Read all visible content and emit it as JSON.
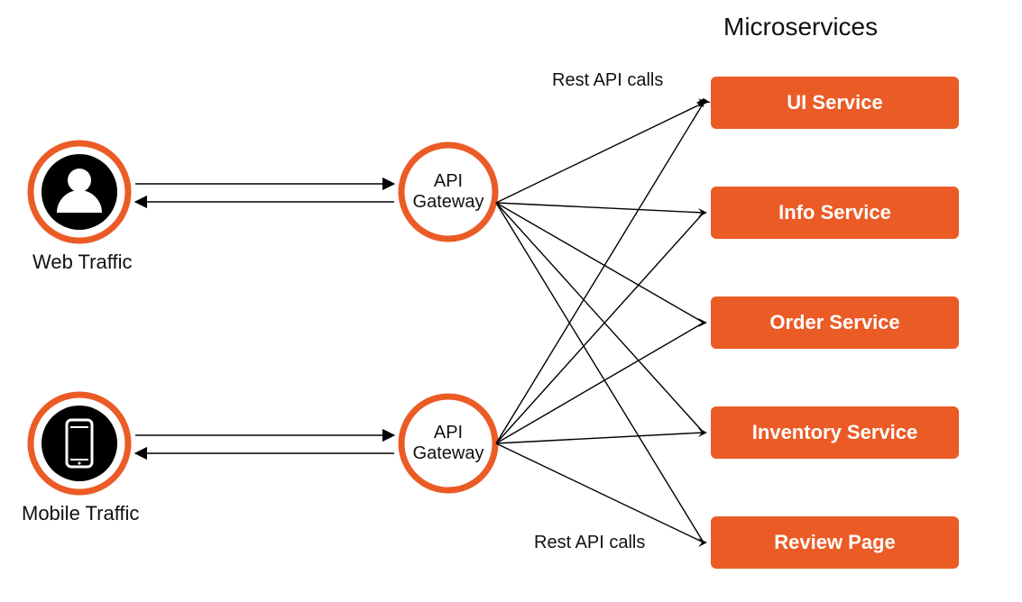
{
  "title": "Microservices",
  "sources": {
    "web": {
      "label": "Web Traffic"
    },
    "mobile": {
      "label": "Mobile Traffic"
    }
  },
  "gateways": {
    "top": {
      "label_line1": "API",
      "label_line2": "Gateway"
    },
    "bottom": {
      "label_line1": "API",
      "label_line2": "Gateway"
    }
  },
  "rest_labels": {
    "top": "Rest API calls",
    "bottom": "Rest API calls"
  },
  "services": [
    {
      "label": "UI Service"
    },
    {
      "label": "Info Service"
    },
    {
      "label": "Order Service"
    },
    {
      "label": "Inventory Service"
    },
    {
      "label": "Review Page"
    }
  ],
  "colors": {
    "accent": "#eb5b26",
    "black": "#000000"
  }
}
